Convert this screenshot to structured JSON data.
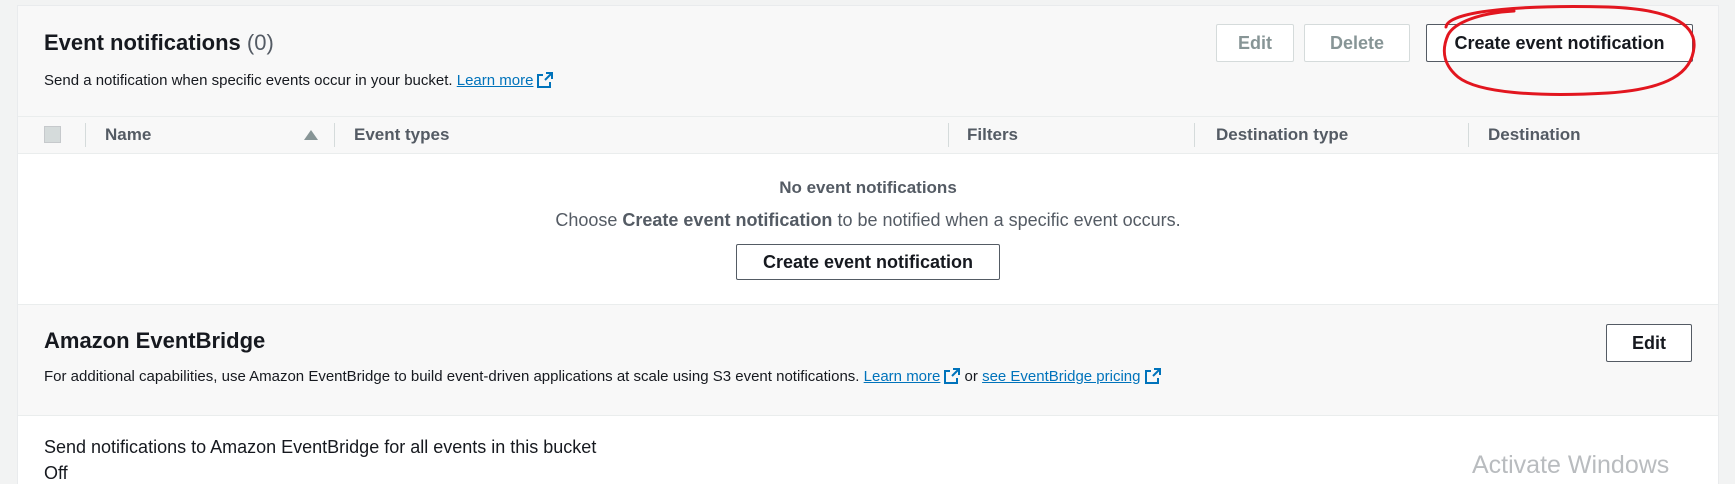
{
  "event_notifications": {
    "title": "Event notifications",
    "count": "(0)",
    "description": "Send a notification when specific events occur in your bucket.",
    "learn_more": "Learn more",
    "buttons": {
      "edit": "Edit",
      "delete": "Delete",
      "create": "Create event notification"
    },
    "table": {
      "columns": [
        "Name",
        "Event types",
        "Filters",
        "Destination type",
        "Destination"
      ],
      "empty_title": "No event notifications",
      "empty_desc_prefix": "Choose",
      "empty_desc_bold": "Create event notification",
      "empty_desc_suffix": "to be notified when a specific event occurs.",
      "empty_button": "Create event notification"
    }
  },
  "eventbridge": {
    "title": "Amazon EventBridge",
    "description": "For additional capabilities, use Amazon EventBridge to build event-driven applications at scale using S3 event notifications.",
    "learn_more": "Learn more",
    "or": "or",
    "pricing_link": "see EventBridge pricing",
    "edit": "Edit",
    "setting_label": "Send notifications to Amazon EventBridge for all events in this bucket",
    "setting_value": "Off"
  },
  "watermark": "Activate Windows",
  "colors": {
    "link": "#0073bb",
    "annotation": "#e2161f",
    "text_secondary": "#545b64"
  }
}
